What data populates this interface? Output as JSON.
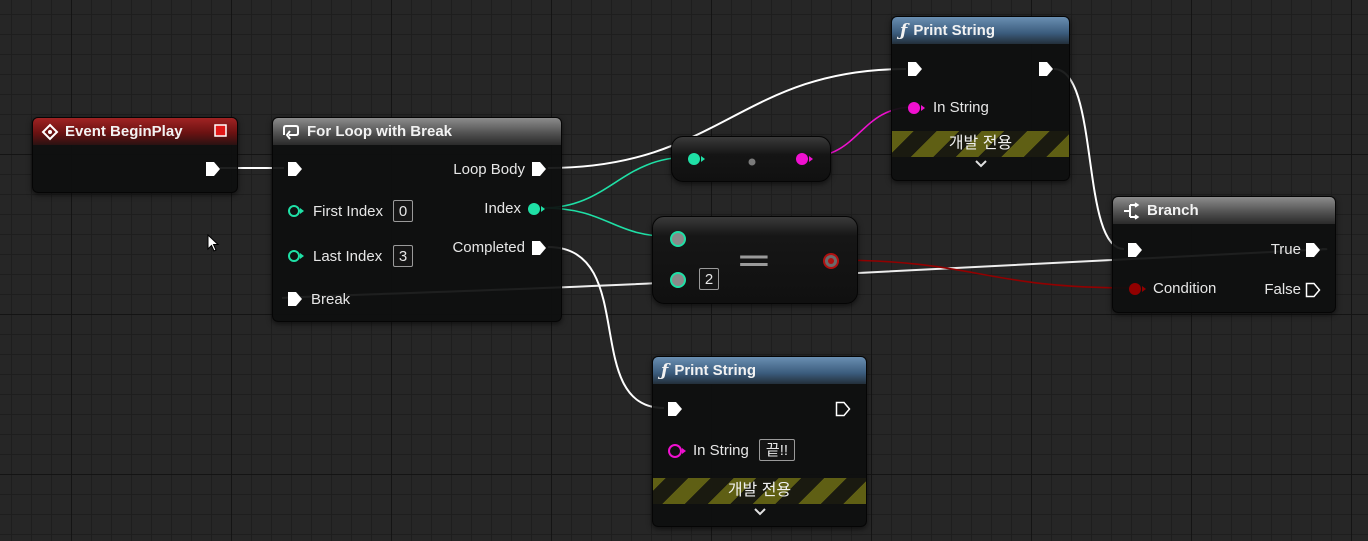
{
  "nodes": {
    "event_begin_play": {
      "title": "Event BeginPlay"
    },
    "for_loop": {
      "title": "For Loop with Break",
      "first_index_label": "First Index",
      "first_index_value": "0",
      "last_index_label": "Last Index",
      "last_index_value": "3",
      "break_label": "Break",
      "loop_body_label": "Loop Body",
      "index_label": "Index",
      "completed_label": "Completed"
    },
    "print_string_top": {
      "title": "Print String",
      "in_string_label": "In String",
      "dev_only": "개발 전용"
    },
    "equal": {
      "symbol": "==",
      "b_value": "2"
    },
    "branch": {
      "title": "Branch",
      "true_label": "True",
      "condition_label": "Condition",
      "false_label": "False"
    },
    "print_string_bottom": {
      "title": "Print String",
      "in_string_label": "In String",
      "in_string_value": "끝!!",
      "dev_only": "개발 전용"
    }
  },
  "colors": {
    "exec_wire": "#ffffff",
    "integer_pin": "#1fe0a6",
    "string_pin": "#f010d0",
    "boolean_pin": "#920000",
    "event_header": "#a02323",
    "function_header": "#3b5c7d",
    "flow_header": "#6a6a6a"
  },
  "icons": [
    "event-diamond-icon",
    "delegate-square-icon",
    "loop-icon",
    "function-icon",
    "branch-icon",
    "mouse-cursor-icon",
    "chevron-down-icon"
  ]
}
